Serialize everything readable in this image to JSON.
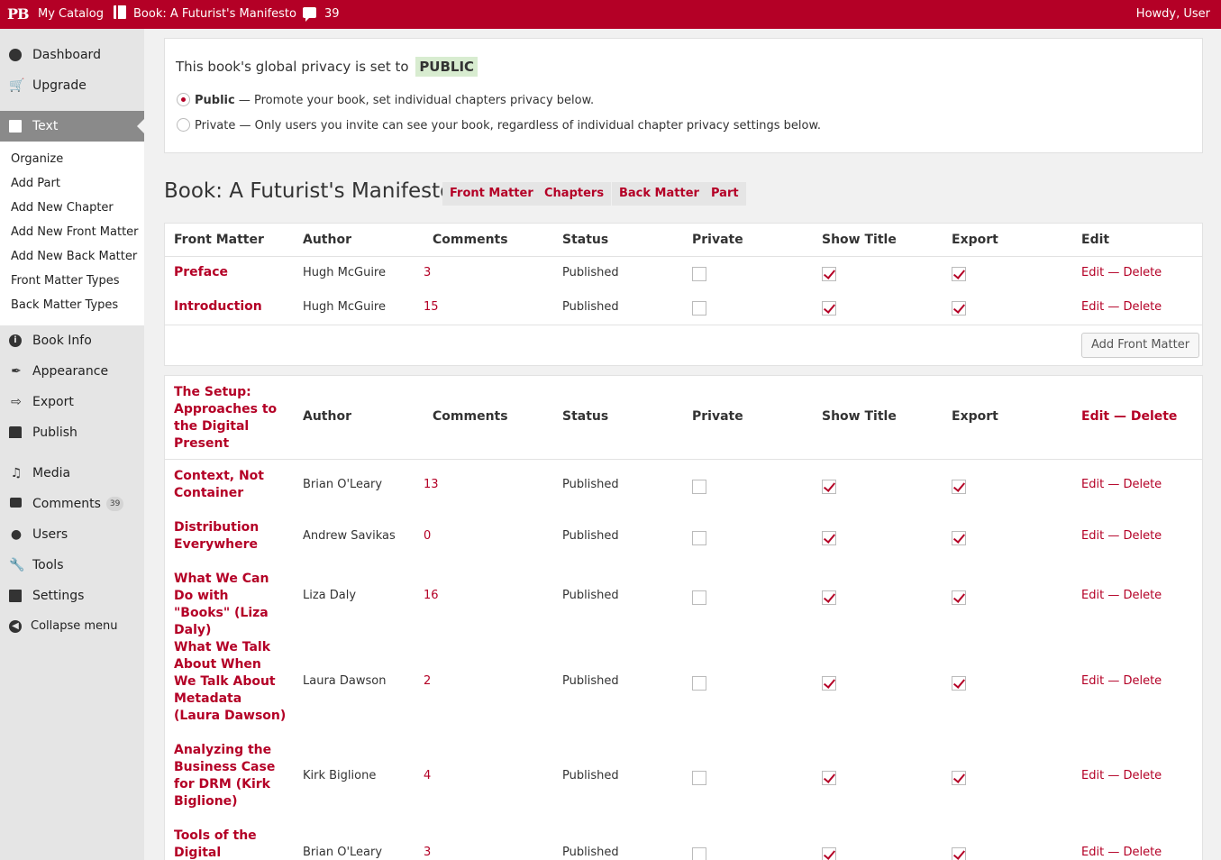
{
  "adminbar": {
    "logo": "PB",
    "catalog": "My Catalog",
    "book": "Book: A Futurist's Manifesto",
    "comment_count": "39",
    "howdy": "Howdy, User"
  },
  "sidebar": {
    "dashboard": "Dashboard",
    "upgrade": "Upgrade",
    "text": "Text",
    "submenu": [
      "Organize",
      "Add Part",
      "Add New Chapter",
      "Add New Front Matter",
      "Add New Back Matter",
      "Front Matter Types",
      "Back Matter Types"
    ],
    "book_info": "Book Info",
    "appearance": "Appearance",
    "export": "Export",
    "publish": "Publish",
    "media": "Media",
    "comments": "Comments",
    "comments_count": "39",
    "users": "Users",
    "tools": "Tools",
    "settings": "Settings",
    "collapse": "Collapse menu"
  },
  "privacy": {
    "prefix": "This book's global privacy is set to",
    "value": "PUBLIC",
    "public_label": "Public",
    "public_desc": " — Promote your book, set individual chapters privacy below.",
    "private_label": "Private",
    "private_desc": " — Only users you invite can see your book, regardless of individual chapter privacy settings below."
  },
  "book": {
    "title": "Book: A Futurist's Manifesto",
    "tags": [
      "Front Matter",
      "Chapters",
      "Back Matter",
      "Part"
    ]
  },
  "front_table": {
    "headers": [
      "Front Matter",
      "Author",
      "Comments",
      "Status",
      "Private",
      "Show Title",
      "Export",
      "Edit"
    ],
    "rows": [
      {
        "title": "Preface",
        "author": "Hugh McGuire",
        "comments": "3",
        "status": "Published",
        "private": false,
        "show_title": true,
        "export": true
      },
      {
        "title": "Introduction",
        "author": "Hugh McGuire",
        "comments": "15",
        "status": "Published",
        "private": false,
        "show_title": true,
        "export": true
      }
    ],
    "add_button": "Add Front Matter"
  },
  "row_actions": {
    "edit": "Edit",
    "sep": " — ",
    "delete": "Delete"
  },
  "part_table": {
    "part_title": "The Setup: Approaches to the Digital Present",
    "headers": [
      "Author",
      "Comments",
      "Status",
      "Private",
      "Show Title",
      "Export"
    ],
    "rows": [
      {
        "title": "Context, Not Container",
        "author": "Brian O'Leary",
        "comments": "13",
        "status": "Published",
        "private": false,
        "show_title": true,
        "export": true
      },
      {
        "title": "Distribution Everywhere",
        "author": "Andrew Savikas",
        "comments": "0",
        "status": "Published",
        "private": false,
        "show_title": true,
        "export": true
      },
      {
        "title": "What We Can Do with \"Books\" (Liza Daly)",
        "author": "Liza Daly",
        "comments": "16",
        "status": "Published",
        "private": false,
        "show_title": true,
        "export": true
      },
      {
        "title": "What We Talk About When We Talk About Metadata (Laura Dawson)",
        "author": "Laura Dawson",
        "comments": "2",
        "status": "Published",
        "private": false,
        "show_title": true,
        "export": true
      },
      {
        "title": "Analyzing the Business Case for DRM (Kirk Biglione)",
        "author": "Kirk Biglione",
        "comments": "4",
        "status": "Published",
        "private": false,
        "show_title": true,
        "export": true
      },
      {
        "title": "Tools of the Digital Workflow",
        "author": "Brian O'Leary",
        "comments": "3",
        "status": "Published",
        "private": false,
        "show_title": true,
        "export": true
      }
    ]
  },
  "colors": {
    "brand": "#b40026",
    "public_bg": "#d8ecd0"
  }
}
